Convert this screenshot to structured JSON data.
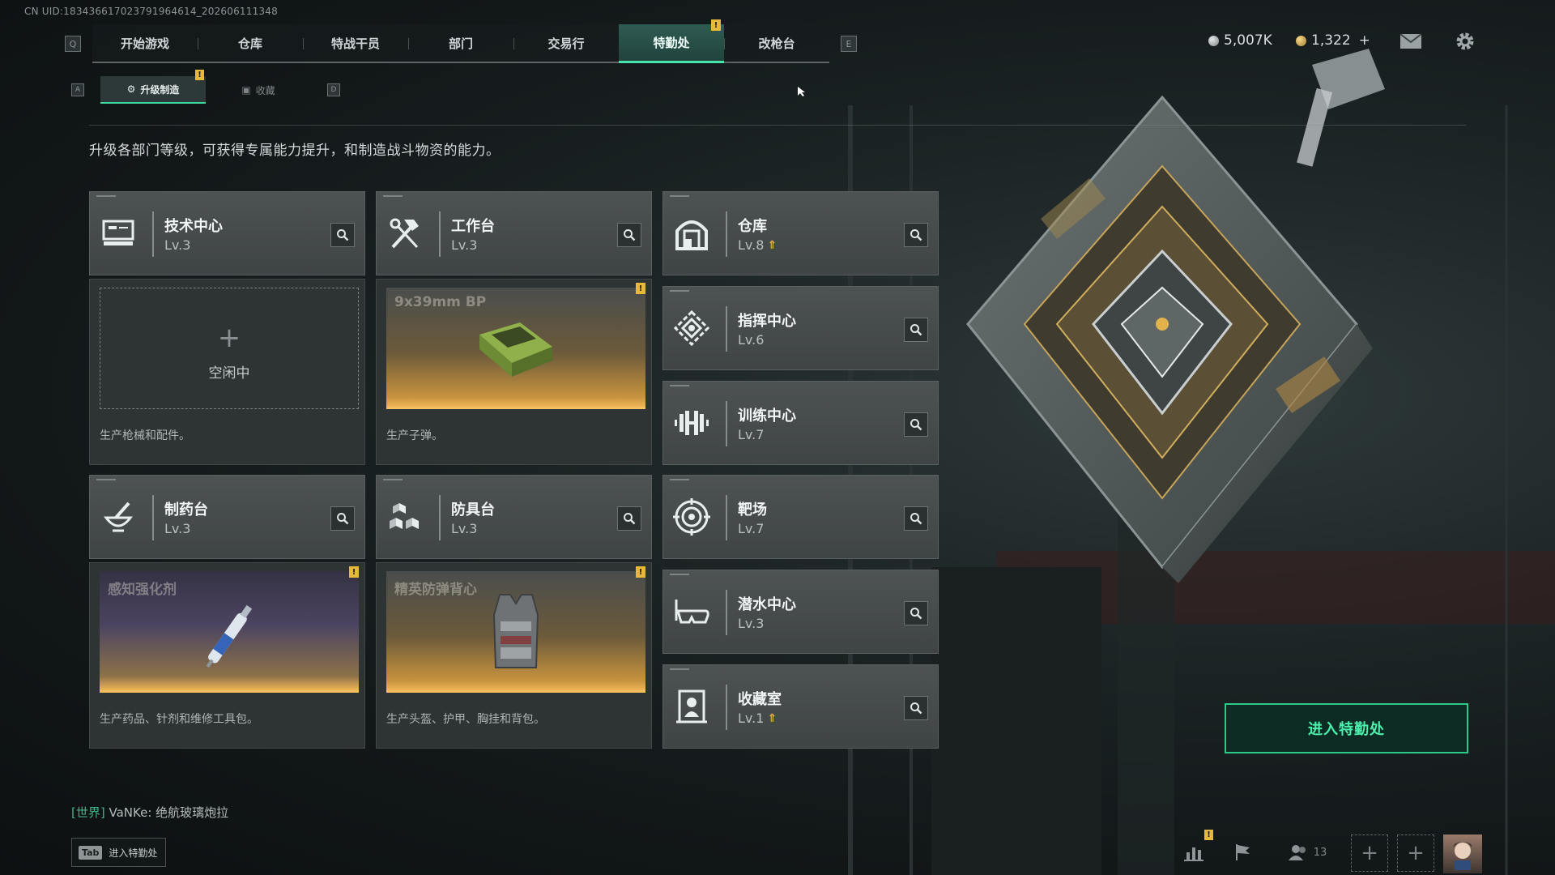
{
  "uid": "CN UID:18343661702379196461­4_202606111348",
  "top_nav": {
    "left_key": "Q",
    "right_key": "E",
    "tabs": [
      {
        "label": "开始游戏",
        "active": false
      },
      {
        "label": "仓库",
        "active": false
      },
      {
        "label": "特战干员",
        "active": false
      },
      {
        "label": "部门",
        "active": false
      },
      {
        "label": "交易行",
        "active": false
      },
      {
        "label": "特勤处",
        "active": true,
        "badge": "!"
      },
      {
        "label": "改枪台",
        "active": false
      }
    ]
  },
  "currency": {
    "silver": "5,007K",
    "gold": "1,322",
    "gold_add": "+"
  },
  "sub_nav": {
    "left_key": "A",
    "right_key": "D",
    "tabs": [
      {
        "label": "升级制造",
        "active": true,
        "badge": "!"
      },
      {
        "label": "收藏",
        "active": false
      }
    ]
  },
  "description": "升级各部门等级，可获得专属能力提升，和制造战斗物资的能力。",
  "departments": {
    "tech": {
      "name": "技术中心",
      "level": "Lv.3",
      "icon": "computer-icon"
    },
    "workbench": {
      "name": "工作台",
      "level": "Lv.3",
      "icon": "tools-icon"
    },
    "warehouse": {
      "name": "仓库",
      "level": "Lv.8",
      "upgrade": "⇑",
      "icon": "vault-icon"
    },
    "command": {
      "name": "指挥中心",
      "level": "Lv.6",
      "icon": "radar-icon"
    },
    "training": {
      "name": "训练中心",
      "level": "Lv.7",
      "icon": "dumbbell-icon"
    },
    "pharmacy": {
      "name": "制药台",
      "level": "Lv.3",
      "icon": "mortar-icon"
    },
    "armor": {
      "name": "防具台",
      "level": "Lv.3",
      "icon": "boxes-icon"
    },
    "range": {
      "name": "靶场",
      "level": "Lv.7",
      "icon": "target-icon"
    },
    "diving": {
      "name": "潜水中心",
      "level": "Lv.3",
      "icon": "goggles-icon"
    },
    "collection": {
      "name": "收藏室",
      "level": "Lv.1",
      "upgrade": "⇑",
      "icon": "bust-icon"
    }
  },
  "production": {
    "tech": {
      "status": "空闲中",
      "plus": "+",
      "caption": "生产枪械和配件。"
    },
    "workbench": {
      "item": "9x39mm BP",
      "badge": "!",
      "caption": "生产子弹。"
    },
    "pharmacy": {
      "item": "感知强化剂",
      "badge": "!",
      "caption": "生产药品、针剂和维修工具包。"
    },
    "armor": {
      "item": "精英防弹背心",
      "badge": "!",
      "caption": "生产头盔、护甲、胸挂和背包。"
    }
  },
  "enter_button": "进入特勤处",
  "chat": {
    "channel": "[世界]",
    "user": "VaNKe:",
    "message": "绝航玻璃炮拉"
  },
  "tab_hint": {
    "key": "Tab",
    "label": "进入特勤处"
  },
  "bottom_bar": {
    "friends_count": "13",
    "badge": "!",
    "add": "+"
  },
  "colors": {
    "accent": "#45e5ad",
    "gold": "#f0b654",
    "badge": "#e7b93a"
  }
}
